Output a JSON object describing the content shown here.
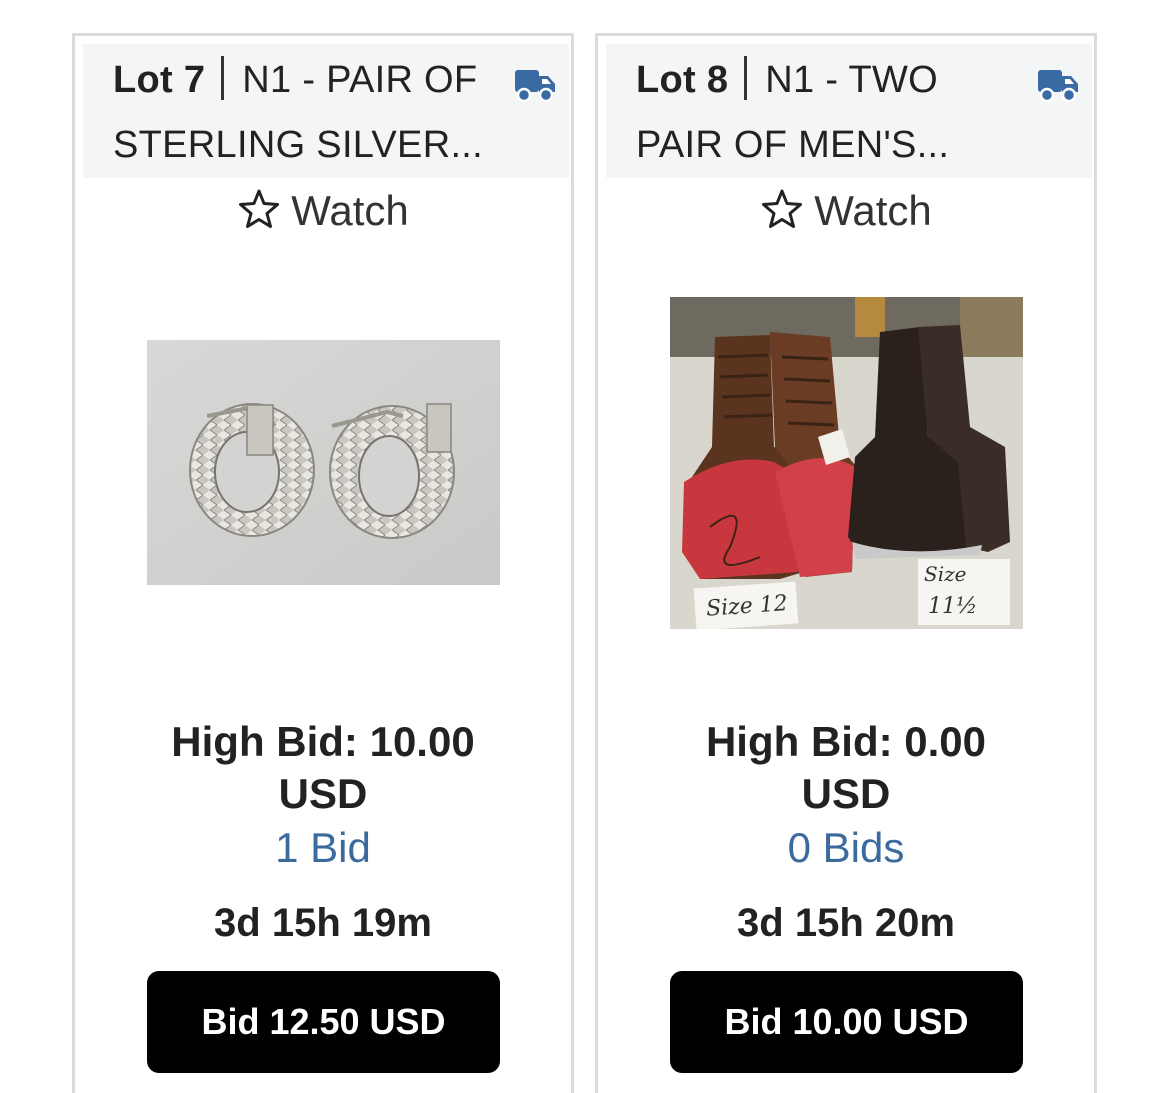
{
  "colors": {
    "truck": "#3a6aa3",
    "bids_link": "#3b6a9c",
    "button_bg": "#000000",
    "header_bg": "#f4f5f6"
  },
  "lots": [
    {
      "lot_label": "Lot 7",
      "title_line1": "N1 - PAIR OF",
      "title_line2": "STERLING SILVER...",
      "watch_label": "Watch",
      "image_icon": "earrings-photo",
      "high_bid_line1": "High Bid: 10.00",
      "high_bid_line2": "USD",
      "bid_count": "1 Bid",
      "time_left": "3d 15h 19m",
      "bid_button": "Bid 12.50 USD"
    },
    {
      "lot_label": "Lot 8",
      "title_line1": "N1 - TWO",
      "title_line2": "PAIR OF MEN'S...",
      "watch_label": "Watch",
      "image_icon": "boots-photo",
      "photo_label_1": "Size 12",
      "photo_label_2a": "Size",
      "photo_label_2b": "11½",
      "high_bid_line1": "High Bid: 0.00",
      "high_bid_line2": "USD",
      "bid_count": "0 Bids",
      "time_left": "3d 15h 20m",
      "bid_button": "Bid 10.00 USD"
    }
  ]
}
